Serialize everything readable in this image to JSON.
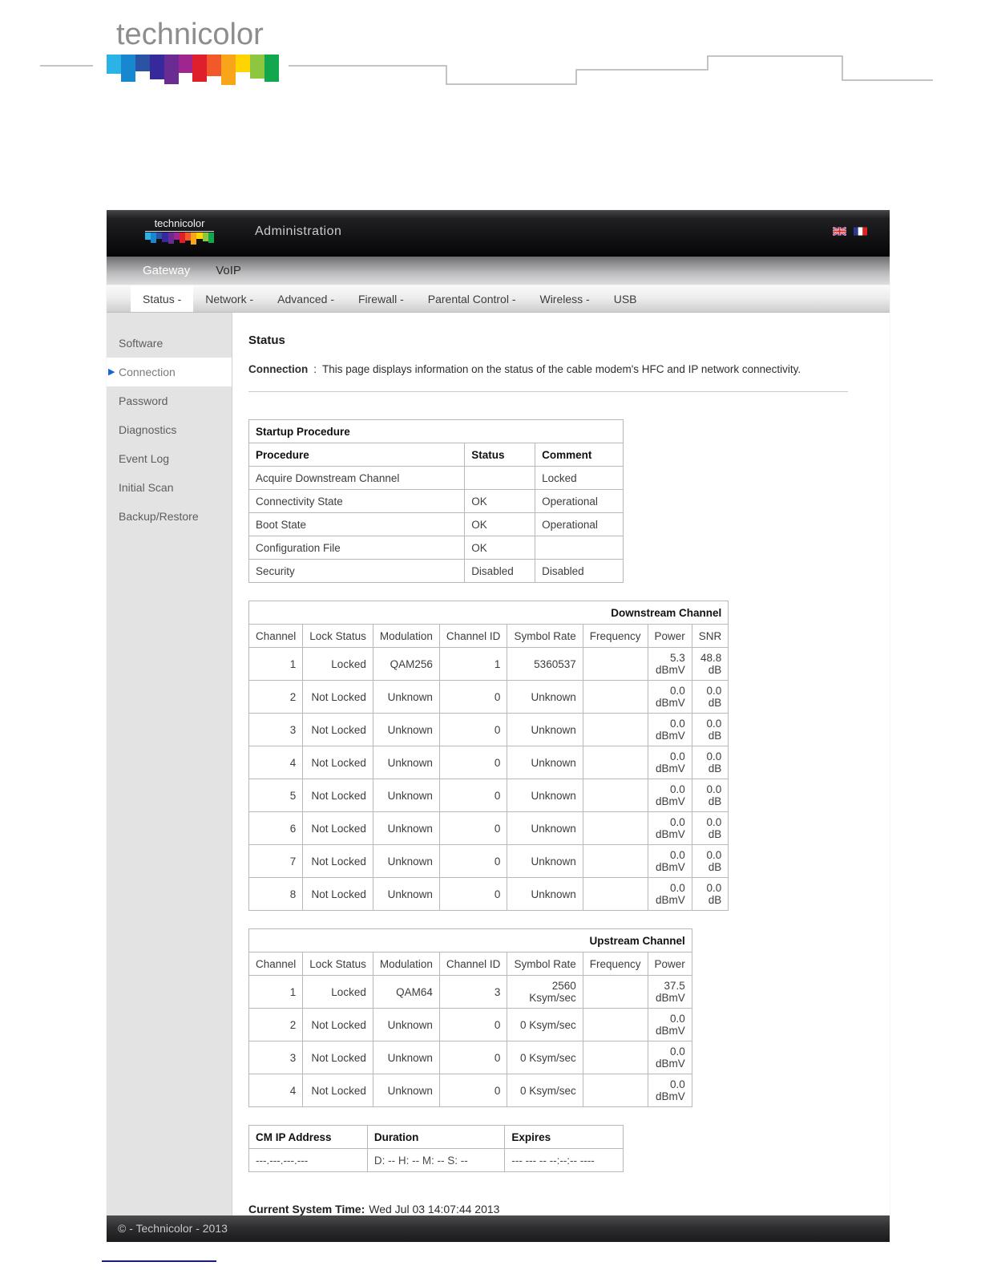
{
  "brand": {
    "wordmark": "technicolor",
    "rainbow_colors": [
      "#2bb3e8",
      "#1787cf",
      "#2b52a3",
      "#35299b",
      "#6a2c93",
      "#a0258f",
      "#e01f2c",
      "#f1592a",
      "#f9a51a",
      "#ffd400",
      "#8dc63f",
      "#12a74c"
    ]
  },
  "header": {
    "title": "Administration",
    "flags": [
      "uk-flag",
      "france-flag"
    ]
  },
  "nav": {
    "context_tabs": [
      {
        "label": "Gateway"
      },
      {
        "label": "VoIP"
      }
    ],
    "menu_items": [
      {
        "label": "Status -"
      },
      {
        "label": "Network -"
      },
      {
        "label": "Advanced -"
      },
      {
        "label": "Firewall -"
      },
      {
        "label": "Parental Control -"
      },
      {
        "label": "Wireless -"
      },
      {
        "label": "USB"
      }
    ]
  },
  "sidebar": {
    "items": [
      {
        "label": "Software"
      },
      {
        "label": "Connection"
      },
      {
        "label": "Password"
      },
      {
        "label": "Diagnostics"
      },
      {
        "label": "Event Log"
      },
      {
        "label": "Initial Scan"
      },
      {
        "label": "Backup/Restore"
      }
    ]
  },
  "main": {
    "page_title": "Status",
    "intro_label": "Connection",
    "intro_separator": ":",
    "intro_text": "This page displays information on the status of the cable modem's HFC and IP network connectivity.",
    "tables": {
      "startup": {
        "title": "Startup Procedure",
        "headers": [
          "Procedure",
          "Status",
          "Comment"
        ],
        "rows": [
          [
            "Acquire Downstream Channel",
            "",
            "Locked"
          ],
          [
            "Connectivity State",
            "OK",
            "Operational"
          ],
          [
            "Boot State",
            "OK",
            "Operational"
          ],
          [
            "Configuration File",
            "OK",
            ""
          ],
          [
            "Security",
            "Disabled",
            "Disabled"
          ]
        ]
      },
      "downstream": {
        "title": "Downstream Channel",
        "headers": [
          "Channel",
          "Lock Status",
          "Modulation",
          "Channel ID",
          "Symbol Rate",
          "Frequency",
          "Power",
          "SNR"
        ],
        "rows": [
          [
            "1",
            "Locked",
            "QAM256",
            "1",
            "5360537",
            "",
            "5.3 dBmV",
            "48.8 dB"
          ],
          [
            "2",
            "Not Locked",
            "Unknown",
            "0",
            "Unknown",
            "",
            "0.0 dBmV",
            "0.0 dB"
          ],
          [
            "3",
            "Not Locked",
            "Unknown",
            "0",
            "Unknown",
            "",
            "0.0 dBmV",
            "0.0 dB"
          ],
          [
            "4",
            "Not Locked",
            "Unknown",
            "0",
            "Unknown",
            "",
            "0.0 dBmV",
            "0.0 dB"
          ],
          [
            "5",
            "Not Locked",
            "Unknown",
            "0",
            "Unknown",
            "",
            "0.0 dBmV",
            "0.0 dB"
          ],
          [
            "6",
            "Not Locked",
            "Unknown",
            "0",
            "Unknown",
            "",
            "0.0 dBmV",
            "0.0 dB"
          ],
          [
            "7",
            "Not Locked",
            "Unknown",
            "0",
            "Unknown",
            "",
            "0.0 dBmV",
            "0.0 dB"
          ],
          [
            "8",
            "Not Locked",
            "Unknown",
            "0",
            "Unknown",
            "",
            "0.0 dBmV",
            "0.0 dB"
          ]
        ]
      },
      "upstream": {
        "title": "Upstream Channel",
        "headers": [
          "Channel",
          "Lock Status",
          "Modulation",
          "Channel ID",
          "Symbol Rate",
          "Frequency",
          "Power"
        ],
        "rows": [
          [
            "1",
            "Locked",
            "QAM64",
            "3",
            "2560 Ksym/sec",
            "",
            "37.5 dBmV"
          ],
          [
            "2",
            "Not Locked",
            "Unknown",
            "0",
            "0 Ksym/sec",
            "",
            "0.0 dBmV"
          ],
          [
            "3",
            "Not Locked",
            "Unknown",
            "0",
            "0 Ksym/sec",
            "",
            "0.0 dBmV"
          ],
          [
            "4",
            "Not Locked",
            "Unknown",
            "0",
            "0 Ksym/sec",
            "",
            "0.0 dBmV"
          ]
        ]
      },
      "cm_ip": {
        "headers": [
          "CM IP Address",
          "Duration",
          "Expires"
        ],
        "rows": [
          [
            "---.---.---.---",
            "D: -- H: -- M: -- S: --",
            "--- --- -- --:--:-- ----"
          ]
        ]
      }
    },
    "system_time_label": "Current System Time:",
    "system_time_value": "Wed Jul 03 14:07:44 2013"
  },
  "footer": {
    "copyright": "© - Technicolor - 2013"
  }
}
